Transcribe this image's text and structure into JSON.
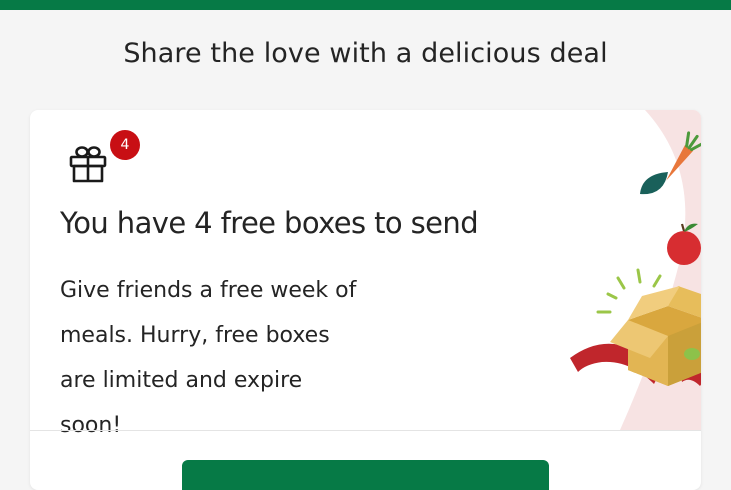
{
  "header": {
    "accent_color": "#067a46",
    "heading": "Share the love with a delicious deal"
  },
  "card": {
    "gift_icon": "gift-icon",
    "badge_count": "4",
    "badge_color": "#c80f14",
    "title": "You have 4 free boxes to send",
    "body": "Give friends a free week of meals. Hurry, free boxes are limited and expire soon!",
    "illustration": "open-box-with-food-icon",
    "cta_label": ""
  }
}
